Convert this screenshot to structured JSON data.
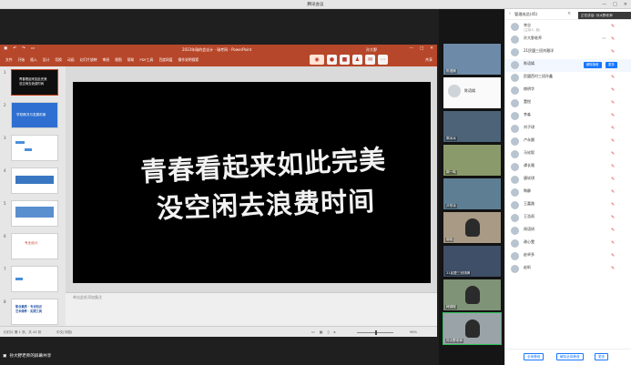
{
  "window": {
    "title": "腾讯会议",
    "controls": [
      "—",
      "□",
      "✕"
    ]
  },
  "powerpoint": {
    "doc_title": "2023年瑞的会议计 - 瑞考网 - PowerPoint",
    "user": "孙大野",
    "ribbon_tabs": [
      "文件",
      "开始",
      "插入",
      "设计",
      "切换",
      "动画",
      "幻灯片放映",
      "审阅",
      "视图",
      "帮助",
      "PDF工具",
      "百度网盘",
      "操作说明搜索"
    ],
    "share_label": "共享",
    "thumbnails": [
      {
        "num": "1",
        "text": "青春看起来如此完美\n没空闲去浪费时间"
      },
      {
        "num": "2",
        "text": "学校概况与发展前景"
      },
      {
        "num": "3",
        "text": ""
      },
      {
        "num": "4",
        "text": ""
      },
      {
        "num": "5",
        "text": ""
      },
      {
        "num": "6",
        "text": "专业设计"
      },
      {
        "num": "7",
        "text": ""
      },
      {
        "num": "8",
        "text": "职业素质 · 专业知识\n艺术修养 · 实践工具"
      }
    ],
    "slide": {
      "line1": "青春看起来如此完美",
      "line2": "没空闲去浪费时间"
    },
    "notes_placeholder": "单击此处添加备注",
    "status": {
      "slide_info": "幻灯片 第 1 张，共 43 张",
      "lang": "中文(中国)",
      "zoom": "96%"
    }
  },
  "sharer": "孙大野老师的屏幕共享",
  "videos": [
    {
      "name": "陈语嫣",
      "type": "video"
    },
    {
      "name": "陈语嫣",
      "type": "avatar"
    },
    {
      "name": "郭冰冰",
      "type": "video"
    },
    {
      "name": "郭一鸣",
      "type": "video"
    },
    {
      "name": "卢冬冰",
      "type": "video"
    },
    {
      "name": "晓晓",
      "type": "video"
    },
    {
      "name": "21民盟三班钱嫣",
      "type": "video"
    },
    {
      "name": "韩锦程",
      "type": "video"
    },
    {
      "name": "孙大野老师",
      "type": "video"
    }
  ],
  "members": {
    "title": "管理成员(45)",
    "recording": "正在讲话: 孙大野老师",
    "list": [
      {
        "name": "李谷",
        "role": "(主持人, 我)"
      },
      {
        "name": "孙大野老师",
        "role": ""
      },
      {
        "name": "21民盟三班刘雅洋",
        "role": ""
      },
      {
        "name": "陈语嫣",
        "role": "",
        "actions": [
          "解除静音",
          "更多"
        ]
      },
      {
        "name": "民盟西村三班孙鑫",
        "role": ""
      },
      {
        "name": "赫明华",
        "role": ""
      },
      {
        "name": "董悦",
        "role": ""
      },
      {
        "name": "李淼",
        "role": ""
      },
      {
        "name": "刘子琪",
        "role": ""
      },
      {
        "name": "卢永晨",
        "role": ""
      },
      {
        "name": "马钦毅",
        "role": ""
      },
      {
        "name": "谭长雅",
        "role": ""
      },
      {
        "name": "唐钦琪",
        "role": ""
      },
      {
        "name": "陶静",
        "role": ""
      },
      {
        "name": "王嘉路",
        "role": ""
      },
      {
        "name": "王浩雨",
        "role": ""
      },
      {
        "name": "闻语妍",
        "role": ""
      },
      {
        "name": "谢心雯",
        "role": ""
      },
      {
        "name": "赵卓多",
        "role": ""
      },
      {
        "name": "赵昕",
        "role": ""
      }
    ],
    "footer": [
      "全体静音",
      "解除全体静音",
      "更多"
    ]
  }
}
